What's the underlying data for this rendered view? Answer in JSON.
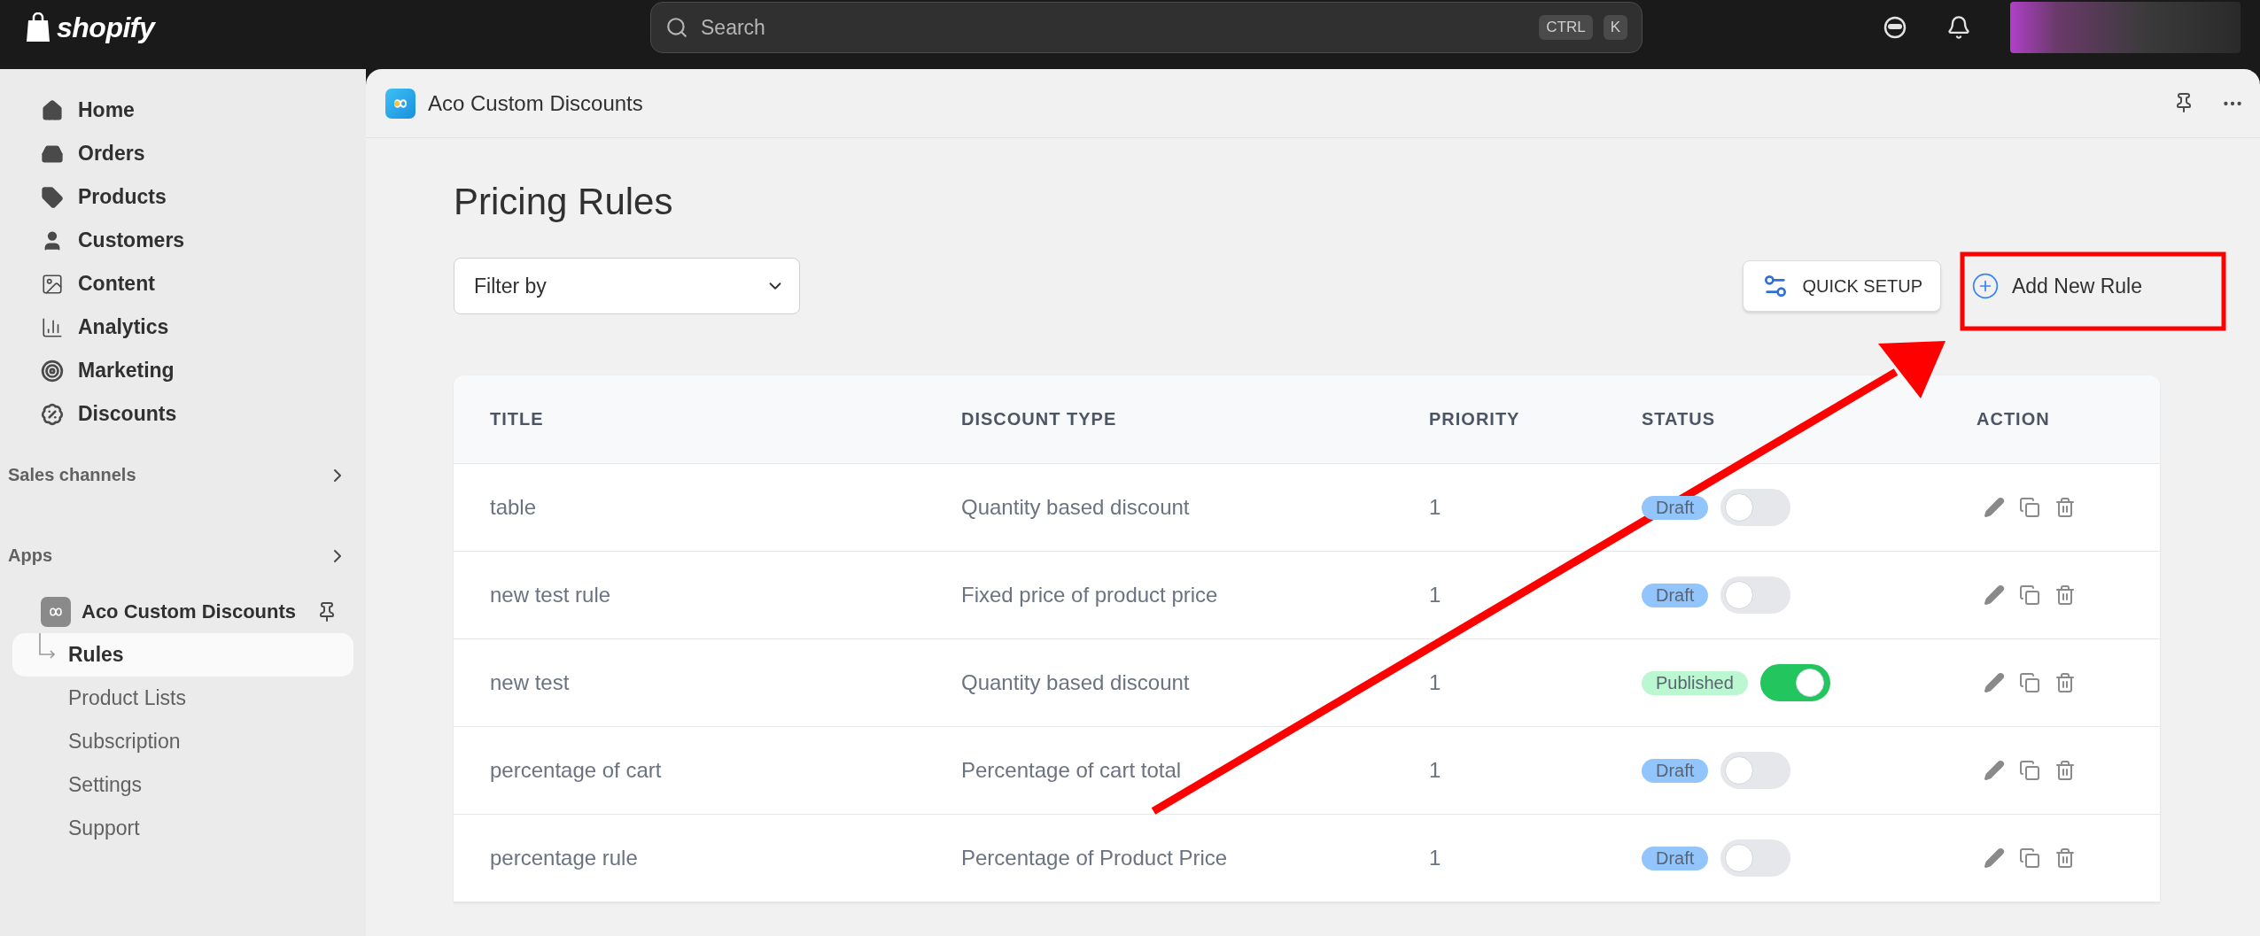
{
  "top_bar": {
    "logo": "shopify",
    "search": {
      "placeholder": "Search",
      "shortcut": [
        "CTRL",
        "K"
      ]
    }
  },
  "sidebar": {
    "items": [
      {
        "label": "Home",
        "selected": false
      },
      {
        "label": "Orders",
        "selected": false
      },
      {
        "label": "Products",
        "selected": false
      },
      {
        "label": "Customers",
        "selected": false
      },
      {
        "label": "Content",
        "selected": false
      },
      {
        "label": "Analytics",
        "selected": false
      },
      {
        "label": "Marketing",
        "selected": false
      },
      {
        "label": "Discounts",
        "selected": false
      }
    ],
    "sections": [
      {
        "label": "Sales channels"
      },
      {
        "label": "Apps"
      }
    ],
    "app": {
      "name": "Aco Custom Discounts",
      "children": [
        {
          "label": "Rules",
          "selected": true
        },
        {
          "label": "Product Lists",
          "selected": false
        },
        {
          "label": "Subscription",
          "selected": false
        },
        {
          "label": "Settings",
          "selected": false
        },
        {
          "label": "Support",
          "selected": false
        }
      ]
    }
  },
  "app_header": {
    "title": "Aco Custom Discounts"
  },
  "page": {
    "title": "Pricing Rules",
    "filter": {
      "value": "Filter by"
    },
    "buttons": [
      {
        "label": "QUICK SETUP",
        "kind": "quick"
      },
      {
        "label": "Add New Rule",
        "kind": "add"
      }
    ]
  },
  "table": {
    "columns": [
      "TITLE",
      "DISCOUNT TYPE",
      "PRIORITY",
      "STATUS",
      "ACTION"
    ],
    "rows": [
      {
        "title": "table",
        "discount_type": "Quantity based discount",
        "priority": "1",
        "status": "Draft",
        "on": false
      },
      {
        "title": "new test rule",
        "discount_type": "Fixed price of product price",
        "priority": "1",
        "status": "Draft",
        "on": false
      },
      {
        "title": "new test",
        "discount_type": "Quantity based discount",
        "priority": "1",
        "status": "Published",
        "on": true
      },
      {
        "title": "percentage of cart",
        "discount_type": "Percentage of cart total",
        "priority": "1",
        "status": "Draft",
        "on": false
      },
      {
        "title": "percentage rule",
        "discount_type": "Percentage of Product Price",
        "priority": "1",
        "status": "Draft",
        "on": false
      }
    ]
  }
}
